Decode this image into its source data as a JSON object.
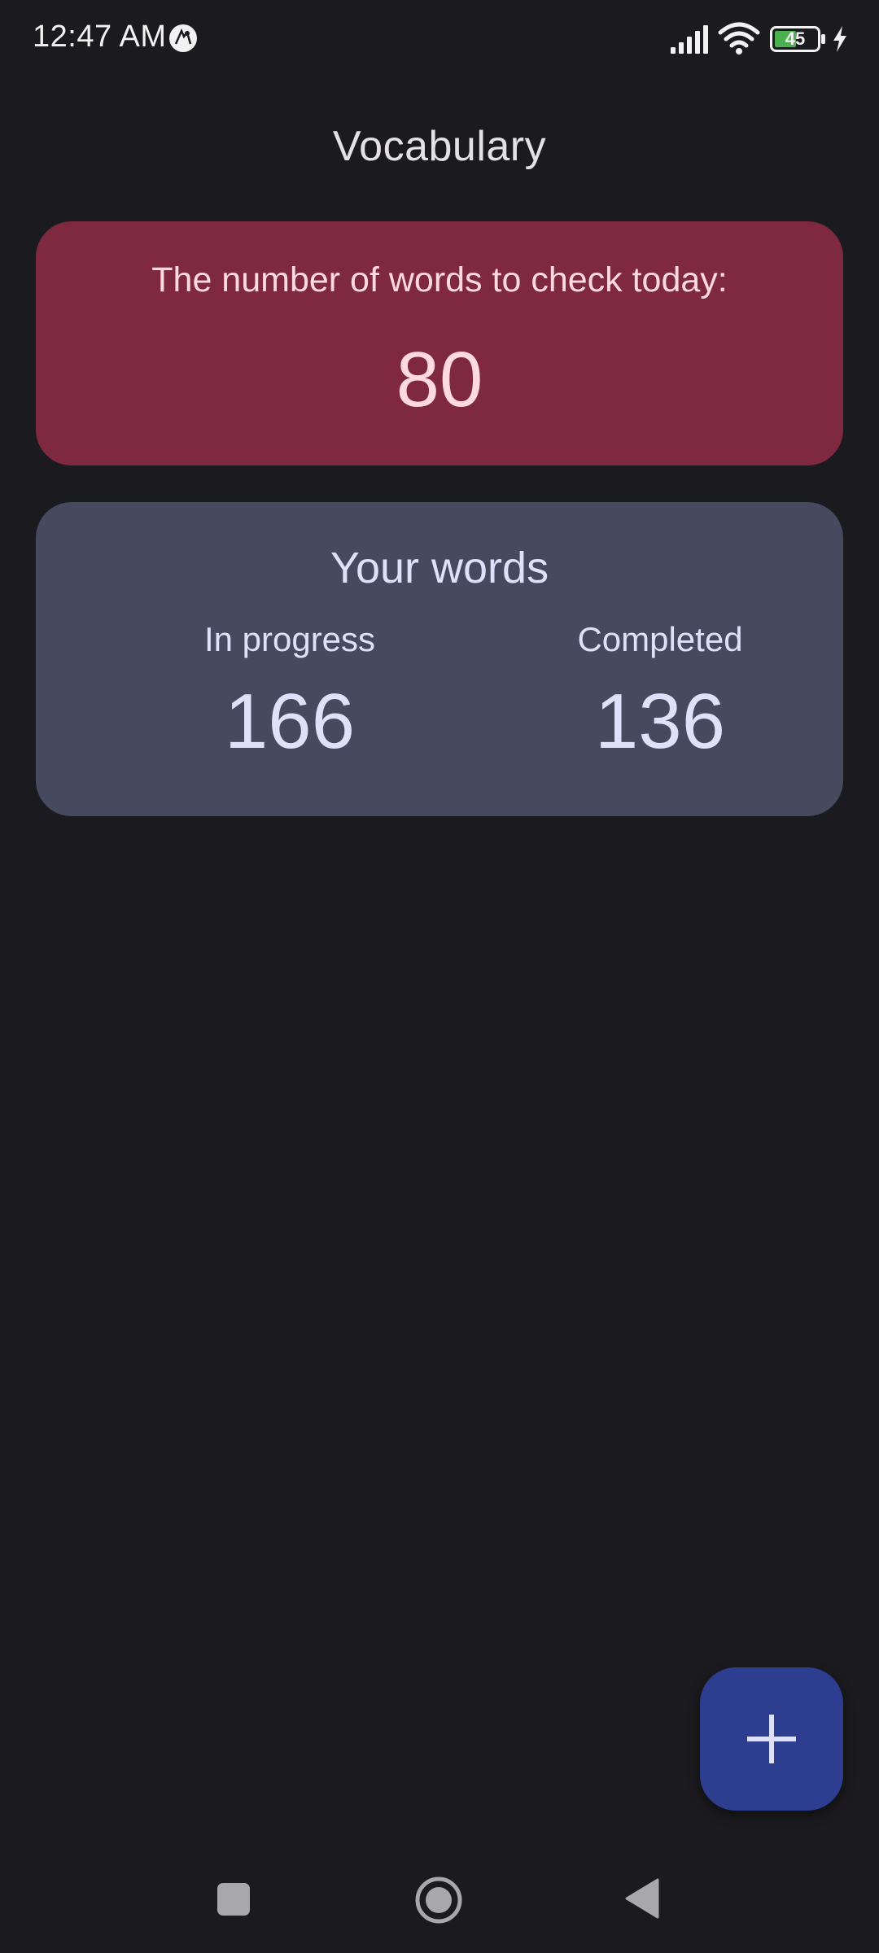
{
  "status_bar": {
    "time": "12:47 AM",
    "battery_level": "45",
    "icons": [
      "app-notification-icon",
      "signal-icon",
      "wifi-icon",
      "battery-icon",
      "charging-icon"
    ]
  },
  "header": {
    "title": "Vocabulary"
  },
  "today_card": {
    "label": "The number of words to check today:",
    "count": "80",
    "background_color": "#7e2940"
  },
  "words_card": {
    "title": "Your words",
    "stats": [
      {
        "label": "In progress",
        "value": "166"
      },
      {
        "label": "Completed",
        "value": "136"
      }
    ],
    "background_color": "#454a5f"
  },
  "fab": {
    "icon": "plus-icon",
    "background_color": "#2d3d8f"
  },
  "nav_bar": {
    "icons": [
      "recent-apps-icon",
      "home-icon",
      "back-icon"
    ]
  },
  "colors": {
    "background": "#1b1b1f",
    "on_surface": "#e4e1e6"
  }
}
